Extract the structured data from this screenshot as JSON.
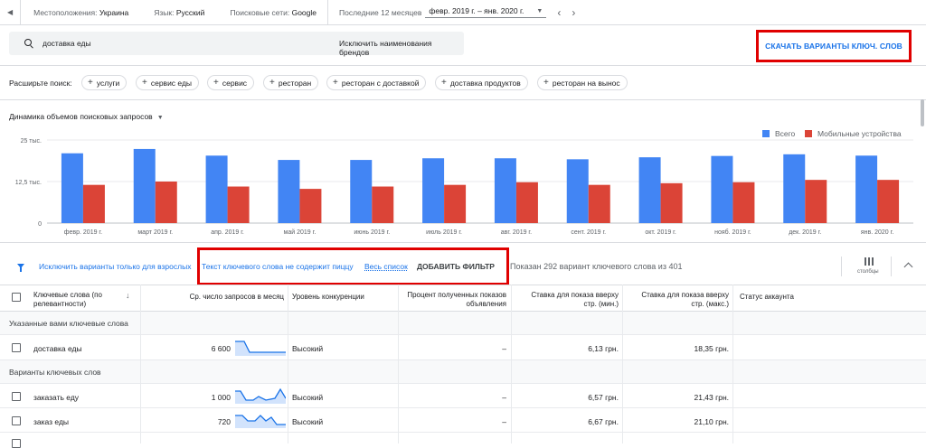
{
  "topbar": {
    "location_label": "Местоположения:",
    "location_value": "Украина",
    "language_label": "Язык:",
    "language_value": "Русский",
    "network_label": "Поисковые сети:",
    "network_value": "Google",
    "period_label": "Последние 12 месяцев",
    "period_value": "февр. 2019 г. – янв. 2020 г."
  },
  "search": {
    "query": "доставка еды",
    "exclude_brands": "Исключить наименования брендов"
  },
  "download_label": "СКАЧАТЬ ВАРИАНТЫ КЛЮЧ. СЛОВ",
  "expand": {
    "label": "Расширьте поиск:",
    "chips": [
      "услуги",
      "сервис еды",
      "сервис",
      "ресторан",
      "ресторан с доставкой",
      "доставка продуктов",
      "ресторан на вынос"
    ]
  },
  "chart_title": "Динамика объемов поисковых запросов",
  "chart_data": {
    "type": "bar",
    "categories": [
      "февр. 2019 г.",
      "март 2019 г.",
      "апр. 2019 г.",
      "май 2019 г.",
      "июнь 2019 г.",
      "июль 2019 г.",
      "авг. 2019 г.",
      "сент. 2019 г.",
      "окт. 2019 г.",
      "нояб. 2019 г.",
      "дек. 2019 г.",
      "янв. 2020 г."
    ],
    "series": [
      {
        "name": "Всего",
        "color": "#4285f4",
        "values": [
          21000,
          22300,
          20300,
          19000,
          19000,
          19500,
          19500,
          19200,
          19800,
          20200,
          20700,
          20300
        ]
      },
      {
        "name": "Мобильные устройства",
        "color": "#db4437",
        "values": [
          11500,
          12500,
          11000,
          10300,
          11000,
          11500,
          12300,
          11500,
          12000,
          12300,
          13000,
          13000
        ]
      }
    ],
    "yticks": [
      {
        "v": 25000,
        "label": "25 тыс."
      },
      {
        "v": 12500,
        "label": "12,5 тыс."
      },
      {
        "v": 0,
        "label": "0"
      }
    ],
    "ylim": [
      0,
      25000
    ],
    "legend": "top-right",
    "grid": true
  },
  "filters": {
    "exclude_adult": "Исключить варианты только для взрослых",
    "not_contains": "Текст ключевого слова не содержит пиццу",
    "full_list": "Весь список",
    "add_filter": "ДОБАВИТЬ ФИЛЬТР",
    "shown": "Показан 292 вариант ключевого слова из 401",
    "columns": "столбцы"
  },
  "table": {
    "headers": {
      "keyword": "Ключевые слова (по релевантности)",
      "searches": "Ср. число запросов в месяц",
      "competition": "Уровень конкуренции",
      "impressions": "Процент полученных показов объявления",
      "bid_low": "Ставка для показа вверху стр. (мин.)",
      "bid_high": "Ставка для показа вверху стр. (макс.)",
      "status": "Статус аккаунта"
    },
    "group1": "Указанные вами ключевые слова",
    "group2": "Варианты ключевых слов",
    "rows": [
      {
        "keyword": "доставка еды",
        "searches": "6 600",
        "competition": "Высокий",
        "impressions": "–",
        "bid_low": "6,13 грн.",
        "bid_high": "18,35 грн."
      },
      {
        "keyword": "заказать еду",
        "searches": "1 000",
        "competition": "Высокий",
        "impressions": "–",
        "bid_low": "6,57 грн.",
        "bid_high": "21,43 грн."
      },
      {
        "keyword": "заказ еды",
        "searches": "720",
        "competition": "Высокий",
        "impressions": "–",
        "bid_low": "6,67 грн.",
        "bid_high": "21,10 грн."
      }
    ]
  }
}
